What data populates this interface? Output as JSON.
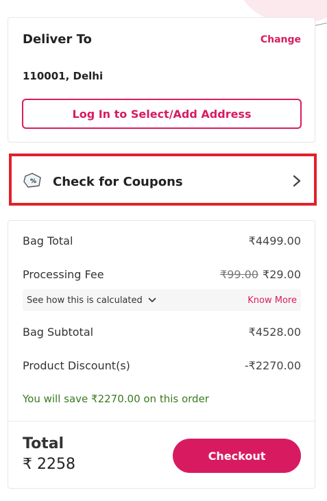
{
  "deliver": {
    "title": "Deliver To",
    "change_label": "Change",
    "address": "110001, Delhi",
    "login_button": "Log In to Select/Add Address"
  },
  "coupon": {
    "label": "Check for Coupons",
    "icon": "coupon-tag-icon",
    "icon_text": "%"
  },
  "price": {
    "bag_total_label": "Bag Total",
    "bag_total_value": "₹4499.00",
    "processing_fee_label": "Processing Fee",
    "processing_fee_original": "₹99.00",
    "processing_fee_value": "₹29.00",
    "calc_link": "See how this is calculated",
    "know_more": "Know More",
    "bag_subtotal_label": "Bag Subtotal",
    "bag_subtotal_value": "₹4528.00",
    "discount_label": "Product Discount(s)",
    "discount_value": "-₹2270.00",
    "savings_text": "You will save ₹2270.00 on this order"
  },
  "footer": {
    "total_label": "Total",
    "total_value": "₹ 2258",
    "checkout_label": "Checkout"
  },
  "colors": {
    "accent": "#d81b60",
    "highlight_border": "#e2202a",
    "savings": "#3a7a1f"
  }
}
